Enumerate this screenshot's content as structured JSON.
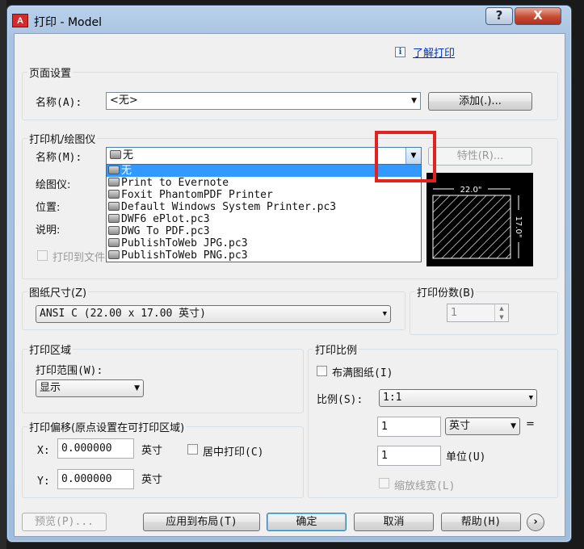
{
  "window": {
    "title": "打印 - Model",
    "app_icon": "A",
    "help_btn": "?",
    "close_btn": "X"
  },
  "info": {
    "link": "了解打印",
    "icon": "i"
  },
  "page_setup": {
    "legend": "页面设置",
    "name_label": "名称(A):",
    "name_value": "<无>",
    "add_button": "添加(.)..."
  },
  "printer": {
    "legend": "打印机/绘图仪",
    "name_label": "名称(M):",
    "name_value": "无",
    "properties_button": "特性(R)...",
    "plotter_label": "绘图仪:",
    "location_label": "位置:",
    "description_label": "说明:",
    "print_to_file": "打印到文件",
    "dropdown_items": [
      "无",
      "Print to Evernote",
      "Foxit PhantomPDF Printer",
      "Default Windows System Printer.pc3",
      "DWF6 ePlot.pc3",
      "DWG To PDF.pc3",
      "PublishToWeb JPG.pc3",
      "PublishToWeb PNG.pc3"
    ],
    "preview": {
      "width_label": "22.0\"",
      "height_label": "17.0\""
    }
  },
  "paper_size": {
    "legend": "图纸尺寸(Z)",
    "value": "ANSI C (22.00 x 17.00 英寸)"
  },
  "copies": {
    "legend": "打印份数(B)",
    "value": "1"
  },
  "plot_area": {
    "legend": "打印区域",
    "range_label": "打印范围(W):",
    "range_value": "显示"
  },
  "plot_offset": {
    "legend": "打印偏移(原点设置在可打印区域)",
    "x_label": "X:",
    "x_value": "0.000000",
    "x_unit": "英寸",
    "y_label": "Y:",
    "y_value": "0.000000",
    "y_unit": "英寸",
    "center": "居中打印(C)"
  },
  "plot_scale": {
    "legend": "打印比例",
    "fit": "布满图纸(I)",
    "scale_label": "比例(S):",
    "scale_value": "1:1",
    "value1": "1",
    "unit1": "英寸",
    "equals": "=",
    "value2": "1",
    "unit2": "单位(U)",
    "scale_lineweights": "缩放线宽(L)"
  },
  "footer": {
    "preview": "预览(P)...",
    "apply": "应用到布局(T)",
    "ok": "确定",
    "cancel": "取消",
    "help": "帮助(H)",
    "expand_icon": "›"
  },
  "colors": {
    "highlight": "#e0231e",
    "selection": "#3399ff",
    "link": "#0033cc"
  }
}
